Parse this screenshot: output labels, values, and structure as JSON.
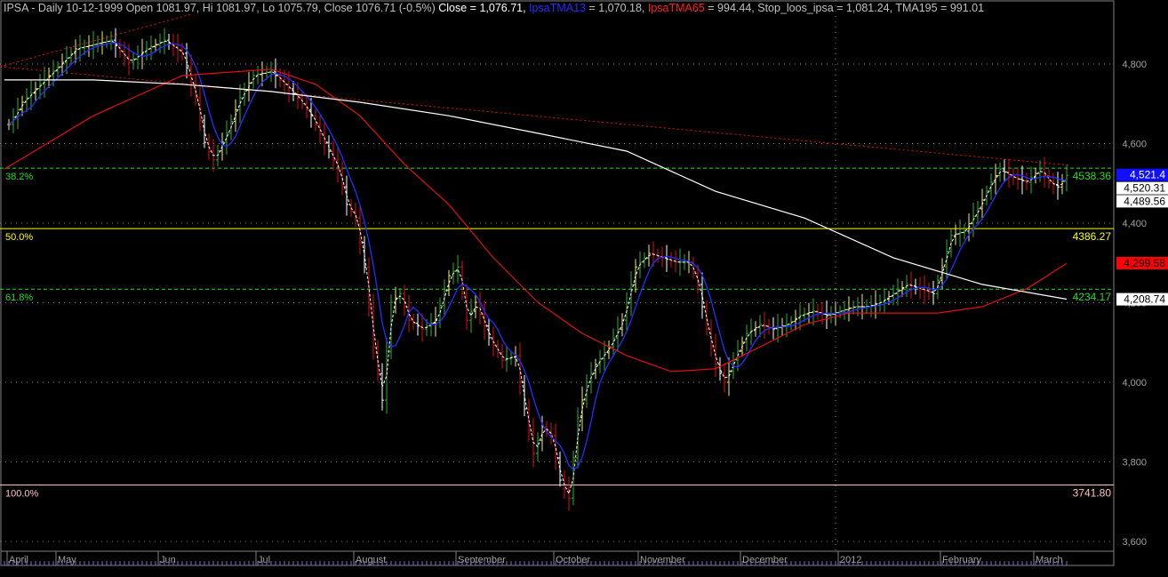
{
  "header": {
    "prefix": "IPSA - Daily 10-12-1999 Open 1081.97, Hi 1081.97, Lo 1075.79, Close 1076.71 (-0.5%)",
    "close": "Close = 1,076.71,",
    "tma13_name": "IpsaTMA13",
    "tma13_val": "= 1,070.18,",
    "tma65_name": "IpsaTMA65",
    "tma65_val": "= 994.44,",
    "rest": "Stop_loos_ipsa = 1,081.24, TMA195 = 991.01"
  },
  "chart_data": {
    "type": "line",
    "title": "IPSA - Daily",
    "ylim": [
      3570,
      4940
    ],
    "y_ticks": [
      "4,800",
      "4,600",
      "4,400",
      "4,200",
      "4,000",
      "3,800",
      "3,600"
    ],
    "y_tick_values": [
      4800,
      4600,
      4400,
      4200,
      4000,
      3800,
      3600
    ],
    "months": [
      {
        "label": "April",
        "day": 1
      },
      {
        "label": "May",
        "day": 12
      },
      {
        "label": "Jun",
        "day": 35
      },
      {
        "label": "Jul",
        "day": 57
      },
      {
        "label": "August",
        "day": 79
      },
      {
        "label": "September",
        "day": 102
      },
      {
        "label": "October",
        "day": 124
      },
      {
        "label": "November",
        "day": 143
      },
      {
        "label": "December",
        "day": 166
      },
      {
        "label": "2012",
        "day": 188
      },
      {
        "label": "February",
        "day": 211
      },
      {
        "label": "March",
        "day": 232
      }
    ],
    "close": [
      [
        1,
        4648
      ],
      [
        4,
        4704
      ],
      [
        8,
        4749
      ],
      [
        12,
        4793
      ],
      [
        16,
        4838
      ],
      [
        20,
        4849
      ],
      [
        24,
        4860
      ],
      [
        28,
        4804
      ],
      [
        32,
        4838
      ],
      [
        36,
        4860
      ],
      [
        40,
        4827
      ],
      [
        43,
        4715
      ],
      [
        45,
        4603
      ],
      [
        47,
        4559
      ],
      [
        50,
        4626
      ],
      [
        53,
        4715
      ],
      [
        56,
        4771
      ],
      [
        60,
        4782
      ],
      [
        63,
        4749
      ],
      [
        66,
        4715
      ],
      [
        69,
        4670
      ],
      [
        72,
        4603
      ],
      [
        75,
        4536
      ],
      [
        77,
        4447
      ],
      [
        79,
        4413
      ],
      [
        81,
        4290
      ],
      [
        83,
        4089
      ],
      [
        85,
        3955
      ],
      [
        87,
        4201
      ],
      [
        89,
        4223
      ],
      [
        91,
        4156
      ],
      [
        94,
        4134
      ],
      [
        97,
        4156
      ],
      [
        100,
        4268
      ],
      [
        102,
        4290
      ],
      [
        104,
        4156
      ],
      [
        106,
        4201
      ],
      [
        109,
        4112
      ],
      [
        112,
        4056
      ],
      [
        115,
        4067
      ],
      [
        117,
        3933
      ],
      [
        119,
        3821
      ],
      [
        121,
        3888
      ],
      [
        123,
        3866
      ],
      [
        125,
        3754
      ],
      [
        127,
        3709
      ],
      [
        129,
        3911
      ],
      [
        131,
        4000
      ],
      [
        133,
        4045
      ],
      [
        136,
        4089
      ],
      [
        139,
        4156
      ],
      [
        142,
        4290
      ],
      [
        145,
        4324
      ],
      [
        148,
        4313
      ],
      [
        151,
        4302
      ],
      [
        154,
        4302
      ],
      [
        156,
        4246
      ],
      [
        158,
        4134
      ],
      [
        160,
        4045
      ],
      [
        162,
        4000
      ],
      [
        164,
        4056
      ],
      [
        167,
        4123
      ],
      [
        170,
        4145
      ],
      [
        173,
        4134
      ],
      [
        176,
        4145
      ],
      [
        179,
        4168
      ],
      [
        182,
        4179
      ],
      [
        185,
        4168
      ],
      [
        188,
        4179
      ],
      [
        191,
        4190
      ],
      [
        194,
        4190
      ],
      [
        197,
        4201
      ],
      [
        200,
        4223
      ],
      [
        203,
        4246
      ],
      [
        206,
        4235
      ],
      [
        209,
        4223
      ],
      [
        211,
        4290
      ],
      [
        213,
        4369
      ],
      [
        216,
        4380
      ],
      [
        219,
        4436
      ],
      [
        222,
        4503
      ],
      [
        224,
        4536
      ],
      [
        227,
        4514
      ],
      [
        230,
        4503
      ],
      [
        233,
        4536
      ],
      [
        235,
        4503
      ],
      [
        237,
        4491
      ],
      [
        239,
        4520
      ]
    ],
    "series": [
      {
        "name": "IpsaTMA65",
        "color": "#e01010",
        "points": [
          [
            0,
            4536
          ],
          [
            20,
            4670
          ],
          [
            40,
            4771
          ],
          [
            60,
            4787
          ],
          [
            70,
            4749
          ],
          [
            80,
            4670
          ],
          [
            90,
            4548
          ],
          [
            100,
            4447
          ],
          [
            110,
            4313
          ],
          [
            120,
            4201
          ],
          [
            130,
            4123
          ],
          [
            140,
            4067
          ],
          [
            150,
            4027
          ],
          [
            160,
            4034
          ],
          [
            170,
            4089
          ],
          [
            180,
            4145
          ],
          [
            190,
            4174
          ],
          [
            200,
            4174
          ],
          [
            210,
            4174
          ],
          [
            220,
            4190
          ],
          [
            230,
            4235
          ],
          [
            239,
            4299
          ]
        ]
      },
      {
        "name": "TMA195",
        "color": "#ffffff",
        "points": [
          [
            0,
            4760
          ],
          [
            20,
            4760
          ],
          [
            40,
            4749
          ],
          [
            60,
            4731
          ],
          [
            80,
            4704
          ],
          [
            100,
            4670
          ],
          [
            120,
            4626
          ],
          [
            140,
            4581
          ],
          [
            160,
            4480
          ],
          [
            180,
            4413
          ],
          [
            200,
            4313
          ],
          [
            220,
            4246
          ],
          [
            239,
            4209
          ]
        ]
      }
    ],
    "fib_levels": [
      {
        "label": "38.2%",
        "value": 4538.36,
        "value_label": "4538.36",
        "color": "#22dd22",
        "style": "dashed"
      },
      {
        "label": "50.0%",
        "value": 4386.27,
        "value_label": "4386.27",
        "color": "#ffff00",
        "style": "solid"
      },
      {
        "label": "61.8%",
        "value": 4234.17,
        "value_label": "4234.17",
        "color": "#22dd22",
        "style": "dashed"
      },
      {
        "label": "100.0%",
        "value": 3741.8,
        "value_label": "3741.80",
        "color": "#ffc0c0",
        "style": "solid"
      }
    ],
    "value_tags": [
      {
        "text": "4,521.4",
        "value": 4521.4,
        "bg": "#1010ff",
        "fg": "#ffffff"
      },
      {
        "text": "4,520.31",
        "value": 4488,
        "bg": "#ffffff",
        "fg": "#000000"
      },
      {
        "text": "4,489.56",
        "value": 4455,
        "bg": "#ffffff",
        "fg": "#000000"
      },
      {
        "text": "4,299.58",
        "value": 4299.58,
        "bg": "#ff0000",
        "fg": "#000000"
      },
      {
        "text": "4,208.74",
        "value": 4208.74,
        "bg": "#ffffff",
        "fg": "#000000"
      }
    ]
  }
}
